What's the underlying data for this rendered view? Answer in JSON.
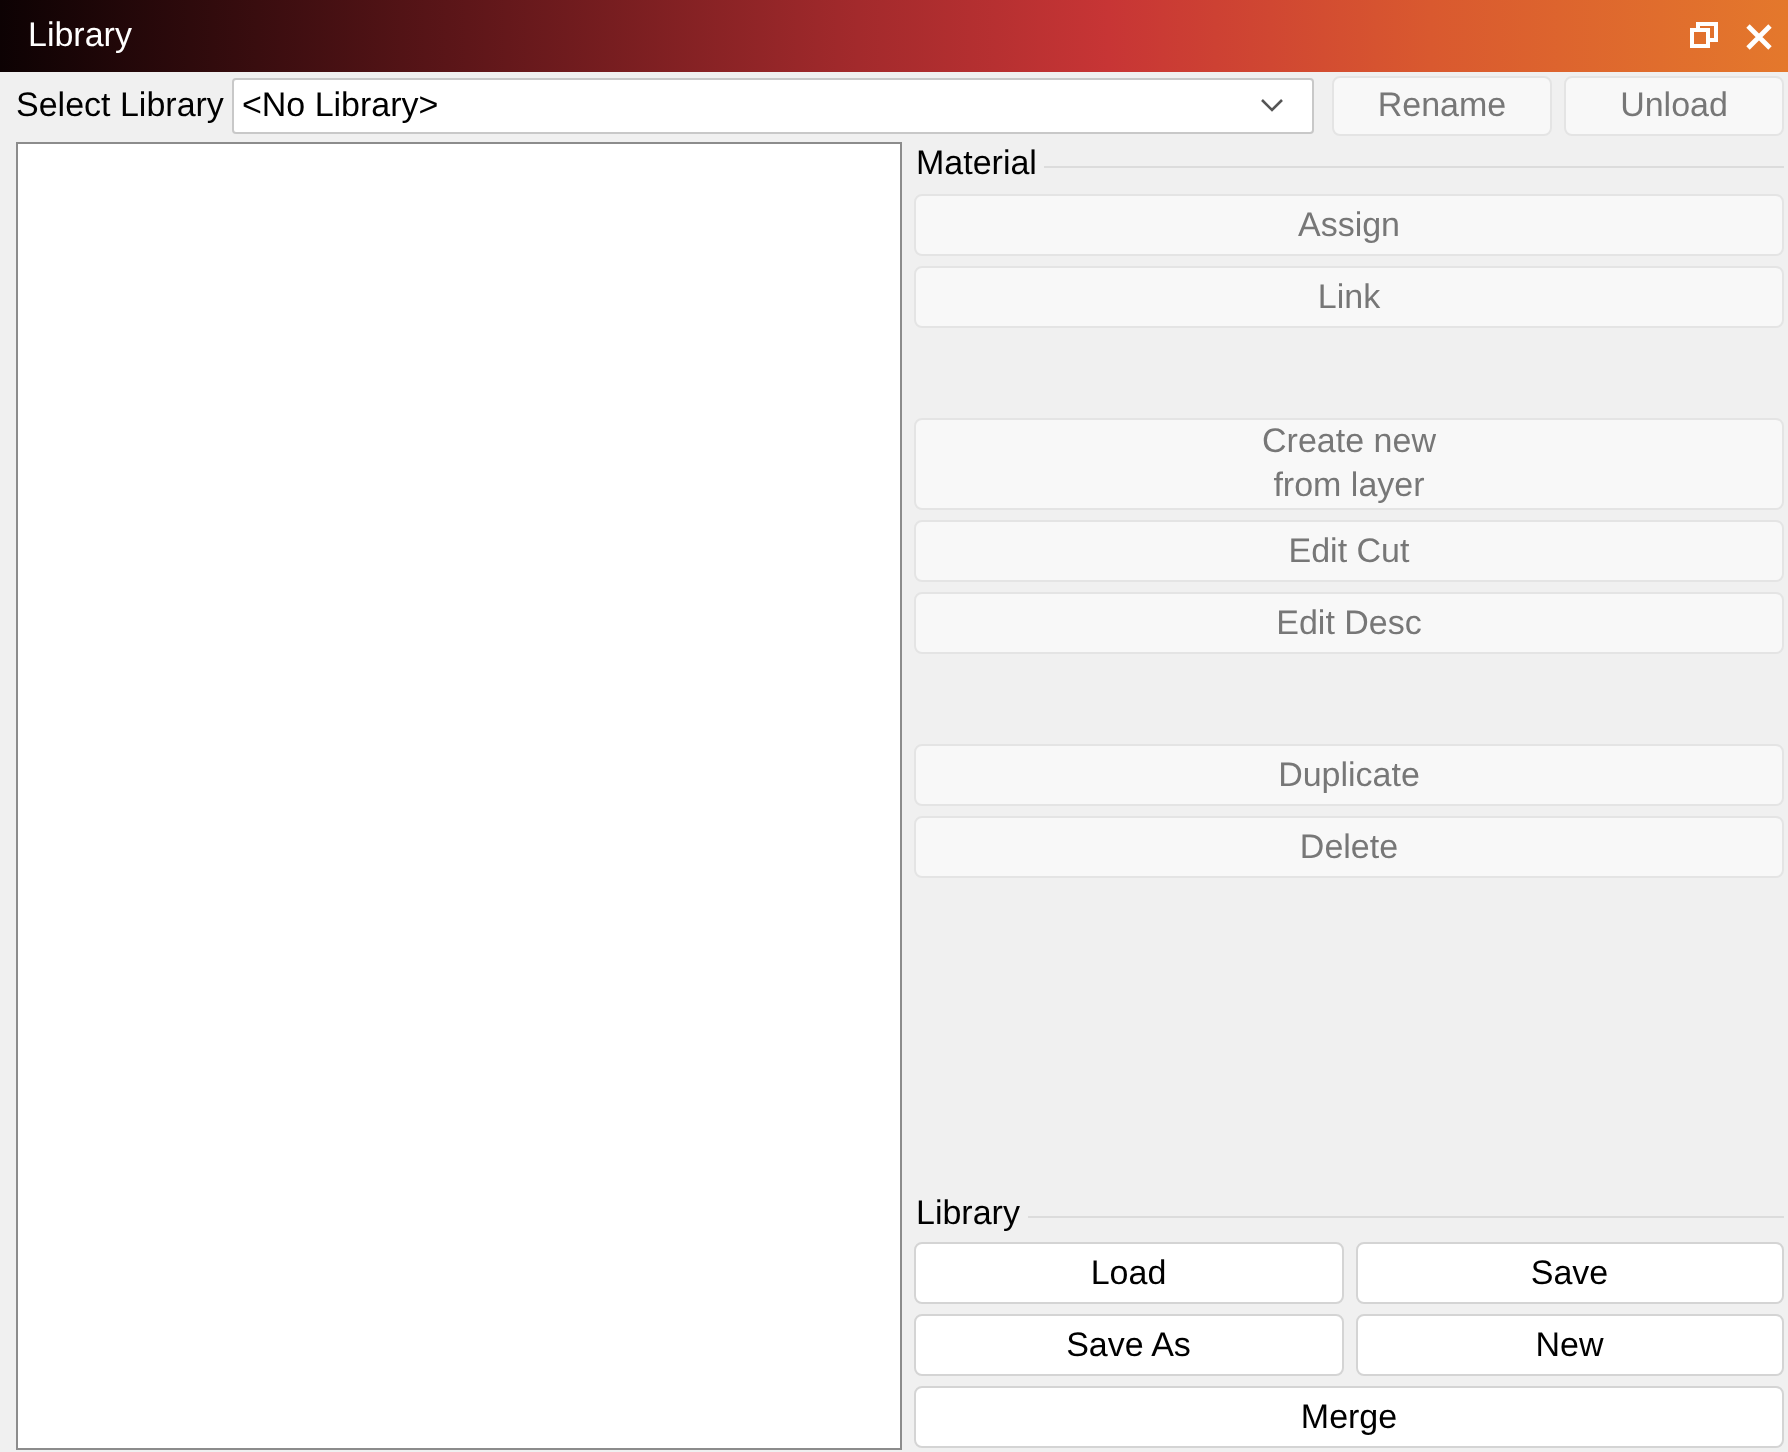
{
  "window": {
    "title": "Library",
    "buttons": [
      {
        "kind": "restore"
      },
      {
        "kind": "close"
      }
    ]
  },
  "select_library": {
    "label": "Select Library",
    "value": "<No Library>",
    "actions": [
      {
        "label": "Rename",
        "disabled": true
      },
      {
        "label": "Unload",
        "disabled": true
      }
    ]
  },
  "material": {
    "title": "Material",
    "groups": [
      [
        {
          "label": "Assign",
          "disabled": true
        },
        {
          "label": "Link",
          "disabled": true
        }
      ],
      [
        {
          "label": "Create new\nfrom layer",
          "disabled": true
        },
        {
          "label": "Edit Cut",
          "disabled": true
        },
        {
          "label": "Edit Desc",
          "disabled": true
        }
      ],
      [
        {
          "label": "Duplicate",
          "disabled": true
        },
        {
          "label": "Delete",
          "disabled": true
        }
      ]
    ]
  },
  "library": {
    "title": "Library",
    "rows": [
      [
        {
          "label": "Load",
          "disabled": false
        },
        {
          "label": "Save",
          "disabled": false
        }
      ],
      [
        {
          "label": "Save As",
          "disabled": false
        },
        {
          "label": "New",
          "disabled": false
        }
      ],
      [
        {
          "label": "Merge",
          "disabled": false
        }
      ]
    ]
  }
}
